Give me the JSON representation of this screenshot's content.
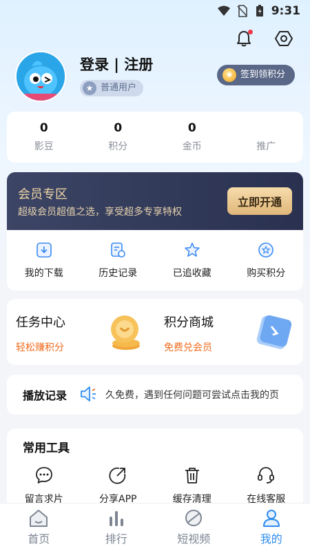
{
  "status_bar": {
    "time": "9:31"
  },
  "header": {
    "notification_icon": "bell-icon",
    "settings_icon": "hexagon-settings-icon",
    "accent": "#f03a4b"
  },
  "profile": {
    "login_label": "登录 | 注册",
    "user_level": "普通用户",
    "checkin_label": "签到领积分"
  },
  "stats": [
    {
      "value": "0",
      "label": "影豆"
    },
    {
      "value": "0",
      "label": "积分"
    },
    {
      "value": "0",
      "label": "金币"
    },
    {
      "value": "",
      "label": "推广"
    }
  ],
  "vip": {
    "title": "会员专区",
    "subtitle": "超级会员超值之选，享受超多专享特权",
    "button_label": "立即开通",
    "gold": "#e0b77a"
  },
  "quick_actions": [
    {
      "label": "我的下载",
      "icon": "download-icon"
    },
    {
      "label": "历史记录",
      "icon": "history-icon"
    },
    {
      "label": "已追收藏",
      "icon": "star-icon"
    },
    {
      "label": "购买积分",
      "icon": "buy-points-icon"
    }
  ],
  "promos": [
    {
      "title": "任务中心",
      "subtitle": "轻松赚积分",
      "icon": "coin-stack-icon"
    },
    {
      "title": "积分商城",
      "subtitle": "免费兑会员",
      "icon": "vip-card-icon"
    }
  ],
  "history": {
    "title": "播放记录",
    "marquee": "久免费，遇到任何问题可尝试点击我的页"
  },
  "tools": {
    "title": "常用工具",
    "items": [
      {
        "label": "留言求片",
        "icon": "message-icon"
      },
      {
        "label": "分享APP",
        "icon": "share-icon"
      },
      {
        "label": "缓存清理",
        "icon": "trash-icon"
      },
      {
        "label": "在线客服",
        "icon": "headset-icon"
      }
    ]
  },
  "tabbar": {
    "items": [
      {
        "label": "首页",
        "icon": "home-icon",
        "active": false
      },
      {
        "label": "排行",
        "icon": "ranking-icon",
        "active": false
      },
      {
        "label": "短视频",
        "icon": "short-video-icon",
        "active": false
      },
      {
        "label": "我的",
        "icon": "profile-icon",
        "active": true
      }
    ],
    "active_color": "#2d8cf0"
  }
}
